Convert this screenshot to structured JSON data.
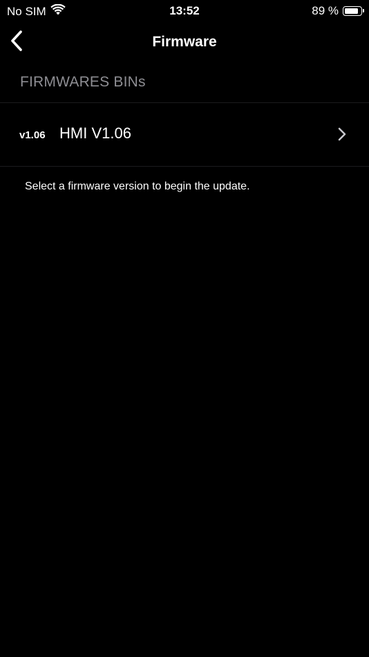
{
  "status_bar": {
    "carrier": "No SIM",
    "time": "13:52",
    "battery_percent_text": "89 %",
    "battery_level": 0.89
  },
  "nav": {
    "title": "Firmware",
    "back_icon": "chevron-left-icon"
  },
  "section": {
    "header": "FIRMWARES BINs"
  },
  "firmware_list": [
    {
      "version": "v1.06",
      "title": "HMI V1.06",
      "accessory_icon": "chevron-right-icon"
    }
  ],
  "footer": {
    "note": "Select a firmware version to begin the update."
  },
  "colors": {
    "background": "#000000",
    "text": "#ffffff",
    "secondary_text": "#8e8e93",
    "separator": "#1c1c1e",
    "chevron": "#c7c7cc"
  }
}
